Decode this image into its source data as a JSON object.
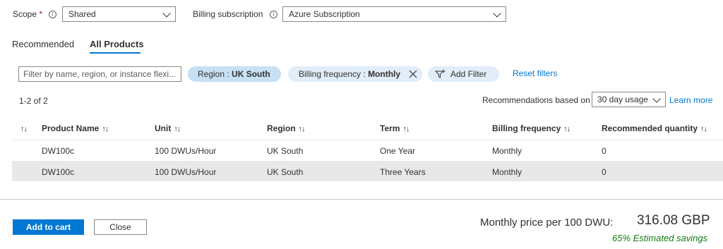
{
  "scope": {
    "label": "Scope",
    "required_mark": "*",
    "value": "Shared"
  },
  "billing_subscription": {
    "label": "Billing subscription",
    "value": "Azure Subscription"
  },
  "tabs": [
    {
      "label": "Recommended",
      "active": false
    },
    {
      "label": "All Products",
      "active": true
    }
  ],
  "filters": {
    "search_placeholder": "Filter by name, region, or instance flexi...",
    "region_key": "Region : ",
    "region_value": "UK South",
    "billing_freq_key": "Billing frequency : ",
    "billing_freq_value": "Monthly",
    "add_filter_label": "Add Filter",
    "reset_label": "Reset filters"
  },
  "results_count": "1-2 of 2",
  "recommendations": {
    "label": "Recommendations based on",
    "value": "30 day usage",
    "learn_more": "Learn more"
  },
  "table": {
    "columns": [
      "Product Name",
      "Unit",
      "Region",
      "Term",
      "Billing frequency",
      "Recommended quantity"
    ],
    "sort_glyph": "↑↓",
    "rows": [
      {
        "product": "DW100c",
        "unit": "100 DWUs/Hour",
        "region": "UK South",
        "term": "One Year",
        "billing": "Monthly",
        "qty": "0"
      },
      {
        "product": "DW100c",
        "unit": "100 DWUs/Hour",
        "region": "UK South",
        "term": "Three Years",
        "billing": "Monthly",
        "qty": "0"
      }
    ]
  },
  "footer": {
    "add_to_cart": "Add to cart",
    "close": "Close",
    "price_label": "Monthly price per 100 DWU:",
    "price_value": "316.08 GBP",
    "savings": "65% Estimated savings"
  },
  "colors": {
    "accent": "#0078d4",
    "savings_green": "#107c10",
    "pill_active_bg": "#c7e0f4",
    "selected_row_bg": "#e8e8e8"
  }
}
